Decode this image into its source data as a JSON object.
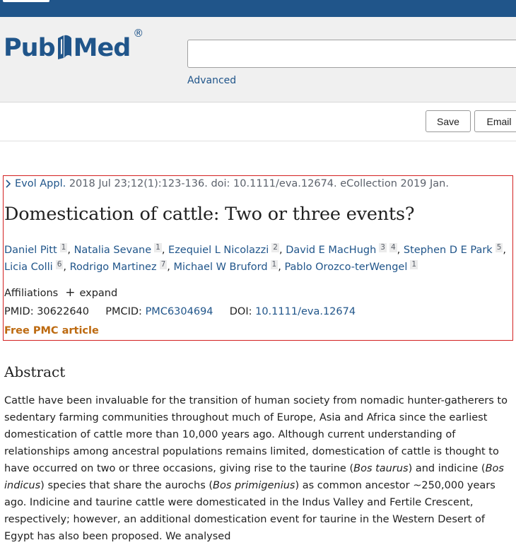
{
  "header": {
    "logo_text_left": "Pub",
    "logo_text_right": "Med",
    "logo_reg": "®",
    "search_value": "",
    "advanced_label": "Advanced"
  },
  "actions": {
    "save_label": "Save",
    "email_label": "Email"
  },
  "article": {
    "journal": "Evol Appl.",
    "citation_rest": " 2018 Jul 23;12(1):123-136. doi: 10.1111/eva.12674. eCollection 2019 Jan.",
    "title": "Domestication of cattle: Two or three events?",
    "authors": [
      {
        "name": "Daniel Pitt",
        "aff": [
          "1"
        ]
      },
      {
        "name": "Natalia Sevane",
        "aff": [
          "1"
        ]
      },
      {
        "name": "Ezequiel L Nicolazzi",
        "aff": [
          "2"
        ]
      },
      {
        "name": "David E MacHugh",
        "aff": [
          "3",
          "4"
        ]
      },
      {
        "name": "Stephen D E Park",
        "aff": [
          "5"
        ]
      },
      {
        "name": "Licia Colli",
        "aff": [
          "6"
        ]
      },
      {
        "name": "Rodrigo Martinez",
        "aff": [
          "7"
        ]
      },
      {
        "name": "Michael W Bruford",
        "aff": [
          "1"
        ]
      },
      {
        "name": "Pablo Orozco-terWengel",
        "aff": [
          "1"
        ]
      }
    ],
    "affiliations_label": "Affiliations",
    "expand_label": "expand",
    "pmid_label": "PMID:",
    "pmid": "30622640",
    "pmcid_label": "PMCID:",
    "pmcid": "PMC6304694",
    "doi_label": "DOI:",
    "doi": "10.1111/eva.12674",
    "free_label": "Free PMC article"
  },
  "abstract": {
    "heading": "Abstract",
    "segments": [
      {
        "text": "Cattle have been invaluable for the transition of human society from nomadic hunter-gatherers to sedentary farming communities throughout much of Europe, Asia and Africa since the earliest domestication of cattle more than 10,000 years ago. Although current understanding of relationships among ancestral populations remains limited, domestication of cattle is thought to have occurred on two or three occasions, giving rise to the taurine (",
        "italic": false
      },
      {
        "text": "Bos taurus",
        "italic": true
      },
      {
        "text": ") and indicine (",
        "italic": false
      },
      {
        "text": "Bos indicus",
        "italic": true
      },
      {
        "text": ") species that share the aurochs (",
        "italic": false
      },
      {
        "text": "Bos primigenius",
        "italic": true
      },
      {
        "text": ") as common ancestor ~250,000 years ago. Indicine and taurine cattle were domesticated in the Indus Valley and Fertile Crescent, respectively; however, an additional domestication event for taurine in the Western Desert of Egypt has also been proposed. We analysed",
        "italic": false
      }
    ]
  },
  "colors": {
    "brand": "#20558a",
    "link": "#20558a",
    "highlight_box": "#d32020",
    "free_pmc": "#bd6a10"
  },
  "icons": {
    "citation_toggle": "chevron-right-icon",
    "expand": "plus-icon"
  }
}
